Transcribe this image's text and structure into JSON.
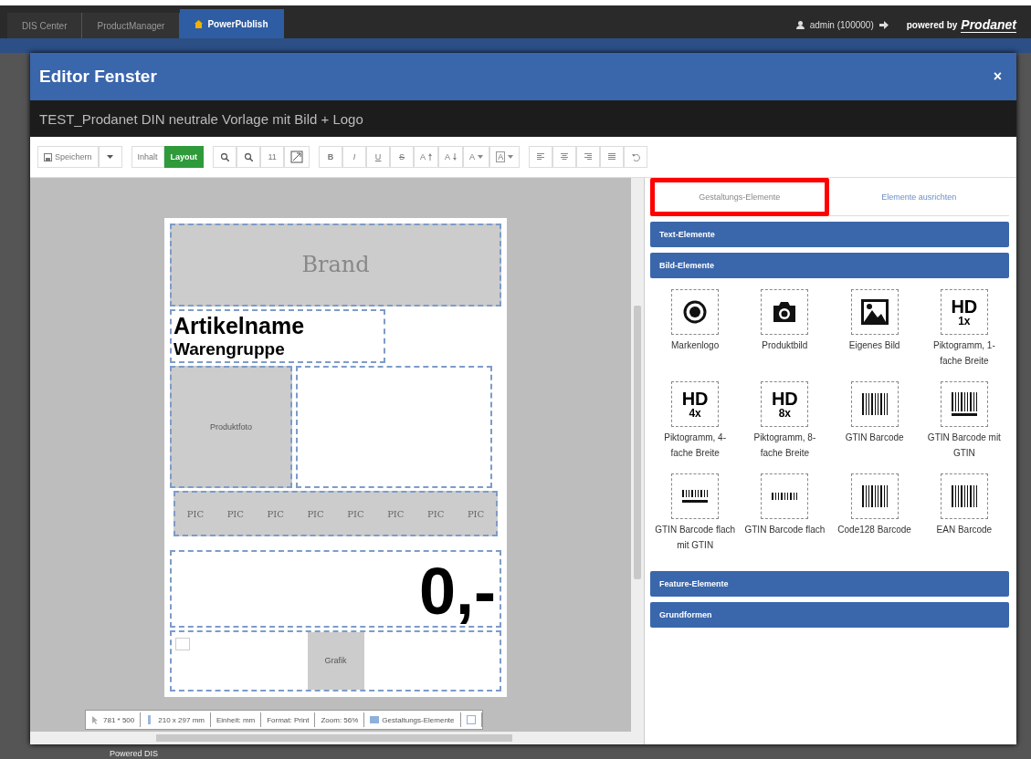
{
  "top_bar": {
    "tabs": [
      {
        "label": "DIS Center",
        "selected": false
      },
      {
        "label": "ProductManager",
        "selected": false
      },
      {
        "label": "PowerPublish",
        "selected": true
      }
    ],
    "user": "admin (100000)",
    "powered_by": "powered by",
    "brand": "Prodanet"
  },
  "footer_text": "Powered DIS",
  "window": {
    "title": "Editor Fenster",
    "close": "×",
    "document_title": "TEST_Prodanet DIN neutrale Vorlage mit Bild + Logo"
  },
  "toolbar": {
    "save": "Speichern",
    "modes": [
      {
        "label": "Inhalt",
        "selected": false
      },
      {
        "label": "Layout",
        "selected": true
      }
    ],
    "font_size": "11",
    "format_buttons": [
      {
        "label": "B",
        "kind": "bold"
      },
      {
        "label": "I",
        "kind": "italic"
      },
      {
        "label": "U",
        "kind": "underline"
      },
      {
        "label": "S",
        "kind": "strike"
      },
      {
        "label": "A",
        "kind": "grow"
      },
      {
        "label": "A",
        "kind": "shrink"
      },
      {
        "label": "A",
        "kind": "color"
      },
      {
        "label": "A",
        "kind": "frame"
      }
    ]
  },
  "canvas": {
    "brand": "Brand",
    "article_name": "Artikelname",
    "product_group": "Warengruppe",
    "product_photo": "Produktfoto",
    "pics": [
      "PIC",
      "PIC",
      "PIC",
      "PIC",
      "PIC",
      "PIC",
      "PIC",
      "PIC"
    ],
    "price": "0,-",
    "graphic": "Grafik"
  },
  "status_bar": [
    {
      "text": "781 * 500",
      "kind": "cursor"
    },
    {
      "text": "210 x 297 mm",
      "kind": "ruler"
    },
    {
      "text": "Einheit: mm",
      "kind": "none"
    },
    {
      "text": "Format: Print",
      "kind": "none"
    },
    {
      "text": "Zoom: 56%",
      "kind": "none"
    },
    {
      "text": "Gestaltungs-Elemente",
      "kind": "panel"
    }
  ],
  "panel": {
    "tabs": [
      {
        "label": "Gestaltungs-Elemente",
        "selected": true,
        "highlighted": true
      },
      {
        "label": "Elemente ausrichten",
        "selected": false,
        "highlighted": false
      }
    ],
    "sections": [
      {
        "title": "Text-Elemente"
      },
      {
        "title": "Bild-Elemente",
        "items": [
          {
            "label": "Markenlogo",
            "kind": "ring"
          },
          {
            "label": "Produktbild",
            "kind": "camera"
          },
          {
            "label": "Eigenes Bild",
            "kind": "image"
          },
          {
            "label": "Piktogramm, 1-fache Breite",
            "kind": "hd",
            "icon_text": "HD",
            "icon_sub": "1x"
          },
          {
            "label": "Piktogramm, 4-fache Breite",
            "kind": "hd",
            "icon_text": "HD",
            "icon_sub": "4x"
          },
          {
            "label": "Piktogramm, 8-fache Breite",
            "kind": "hd",
            "icon_text": "HD",
            "icon_sub": "8x"
          },
          {
            "label": "GTIN Barcode",
            "kind": "barcode"
          },
          {
            "label": "GTIN Barcode mit GTIN",
            "kind": "barcode-digits"
          },
          {
            "label": "GTIN Barcode flach mit GTIN",
            "kind": "flat-digits"
          },
          {
            "label": "GTIN Barcode flach",
            "kind": "flat"
          },
          {
            "label": "Code128 Barcode",
            "kind": "barcode"
          },
          {
            "label": "EAN Barcode",
            "kind": "barcode"
          }
        ]
      },
      {
        "title": "Feature-Elemente"
      },
      {
        "title": "Grundformen"
      }
    ]
  }
}
